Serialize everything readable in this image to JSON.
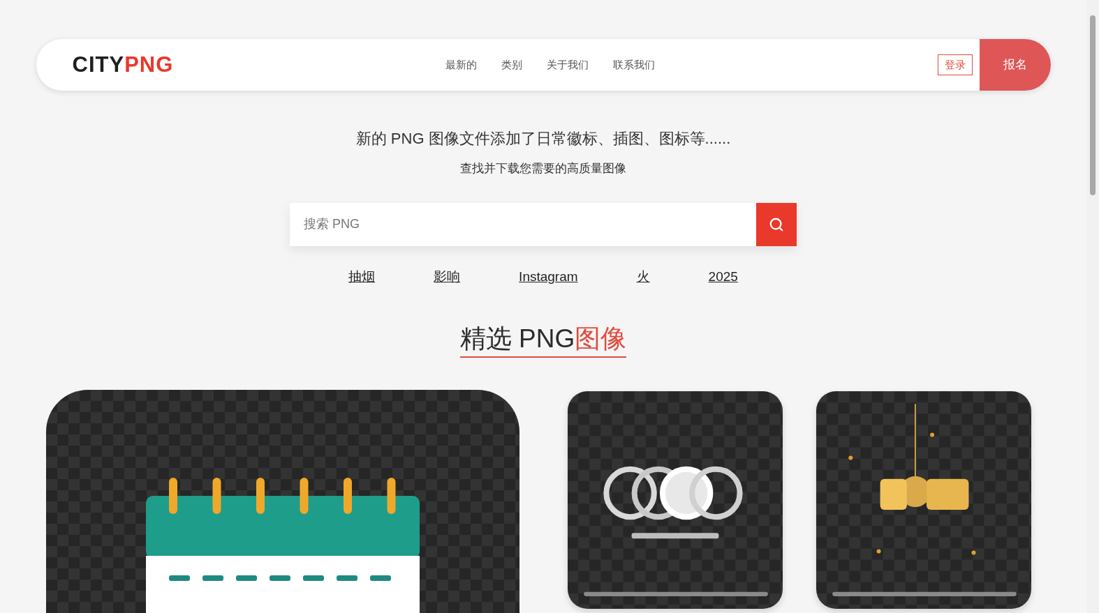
{
  "header": {
    "logo": {
      "dark": "CITY",
      "accent": "PNG"
    },
    "nav": [
      "最新的",
      "类别",
      "关于我们",
      "联系我们"
    ],
    "login": "登录",
    "signup": "报名"
  },
  "hero": {
    "headline": "新的 PNG 图像文件添加了日常徽标、插图、图标等......",
    "subline": "查找并下载您需要的高质量图像",
    "search": {
      "placeholder": "搜索 PNG"
    },
    "tags": [
      "抽烟",
      "影响",
      "Instagram",
      "火",
      "2025"
    ]
  },
  "featured": {
    "title": "精选 PNG",
    "title_accent": "图像",
    "cards": [
      {
        "kind": "calendar"
      },
      {
        "kind": "silver"
      },
      {
        "kind": "gold"
      }
    ]
  }
}
